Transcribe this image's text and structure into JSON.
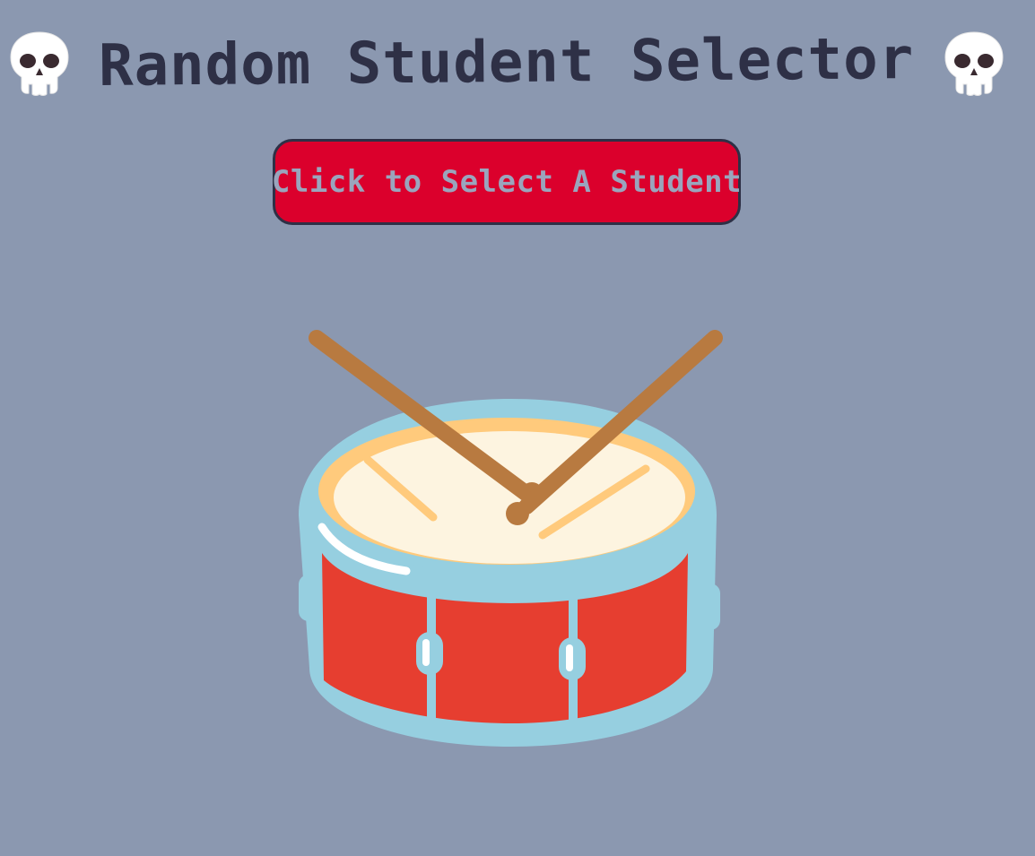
{
  "header": {
    "title": "Random Student Selector",
    "left_icon": "skull-icon",
    "right_icon": "skull-icon"
  },
  "action": {
    "select_label": "Click to Select A Student"
  },
  "illustration": {
    "icon": "drum-icon"
  },
  "colors": {
    "background": "#8b98b0",
    "title_text": "#2e3046",
    "button_fill": "#db002c",
    "button_text": "#9aa5bd",
    "button_border": "#2e3046",
    "drum_shell": "#e63e30",
    "drum_rim": "#96cfe0",
    "drum_head": "#fdf4e0",
    "drumsticks": "#b87a40"
  }
}
